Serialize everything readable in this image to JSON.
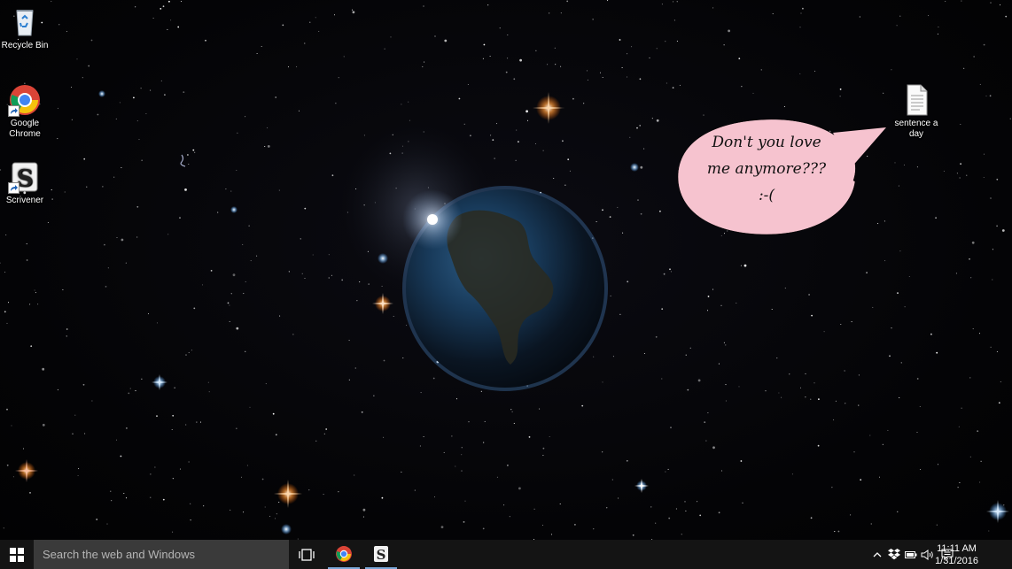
{
  "desktop": {
    "icons": [
      {
        "label": "Recycle Bin",
        "icon": "recycle-bin-icon"
      },
      {
        "label": "Google Chrome",
        "icon": "chrome-icon"
      },
      {
        "label": "Scrivener",
        "icon": "scrivener-icon"
      },
      {
        "label": "sentence a day",
        "icon": "text-document-icon"
      }
    ],
    "speech_bubble": {
      "line1": "Don't you love",
      "line2": "me anymore???",
      "line3": ":-(",
      "color": "#f6c3cf"
    },
    "wallpaper": "earth-in-space"
  },
  "taskbar": {
    "search_placeholder": "Search the web and Windows",
    "pinned": [
      "start-icon",
      "task-view-icon",
      "chrome-icon",
      "scrivener-icon"
    ],
    "clock": {
      "time": "11:11 AM",
      "date": "1/31/2016"
    },
    "tray": [
      "chevron-up-icon",
      "dropbox-icon",
      "battery-icon",
      "volume-icon",
      "notifications-icon"
    ],
    "accent": "#7aa7d8"
  }
}
